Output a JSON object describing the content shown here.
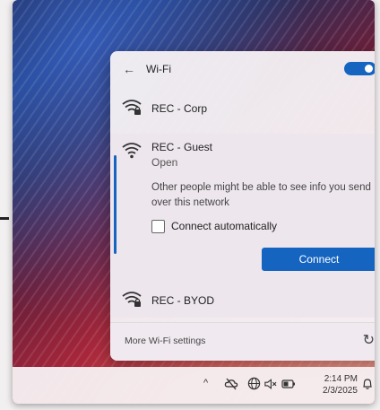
{
  "flyout": {
    "back_glyph": "←",
    "title": "Wi-Fi",
    "toggle_on": true,
    "networks": [
      {
        "name": "REC - Corp",
        "icon": "wifi-lock-icon",
        "secured": true
      },
      {
        "name": "REC - Guest",
        "status": "Open",
        "icon": "wifi-icon",
        "secured": false,
        "expanded": true
      },
      {
        "name": "REC - BYOD",
        "icon": "wifi-lock-icon",
        "secured": true
      }
    ],
    "warning": "Other people might be able to see info you send over this network",
    "connect_automatically_label": "Connect automatically",
    "connect_automatically_checked": false,
    "connect_button": "Connect",
    "more_settings": "More Wi-Fi settings",
    "refresh_glyph": "↻"
  },
  "taskbar": {
    "chevron_glyph": "^",
    "time": "2:14 PM",
    "date": "2/3/2025"
  },
  "colors": {
    "accent": "#1565c0"
  }
}
